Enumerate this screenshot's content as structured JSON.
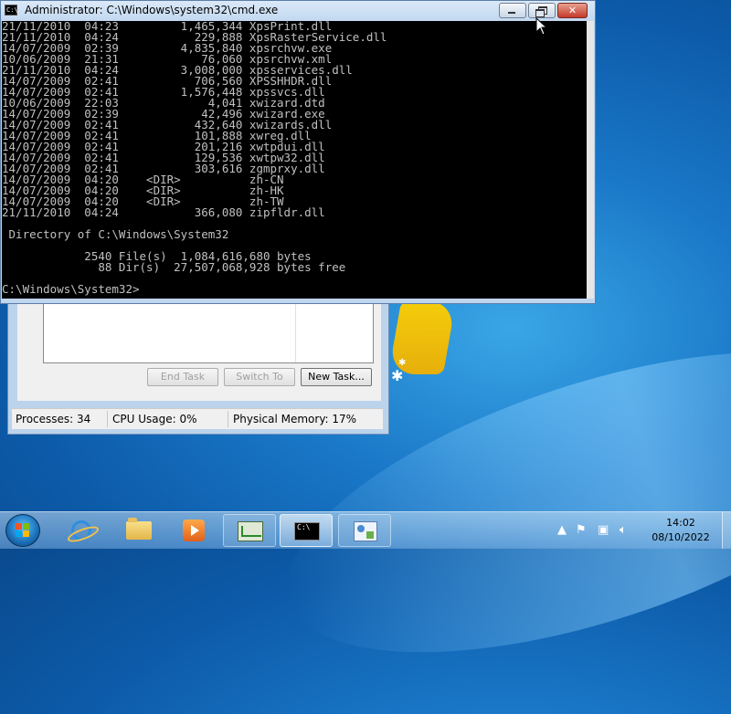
{
  "cmd": {
    "title": "Administrator: C:\\Windows\\system32\\cmd.exe",
    "icon_label": "C:\\",
    "lines": [
      "21/11/2010  04:23         1,465,344 XpsPrint.dll",
      "21/11/2010  04:24           229,888 XpsRasterService.dll",
      "14/07/2009  02:39         4,835,840 xpsrchvw.exe",
      "10/06/2009  21:31            76,060 xpsrchvw.xml",
      "21/11/2010  04:24         3,008,000 xpsservices.dll",
      "14/07/2009  02:41           706,560 XPSSHHDR.dll",
      "14/07/2009  02:41         1,576,448 xpssvcs.dll",
      "10/06/2009  22:03             4,041 xwizard.dtd",
      "14/07/2009  02:39            42,496 xwizard.exe",
      "14/07/2009  02:41           432,640 xwizards.dll",
      "14/07/2009  02:41           101,888 xwreg.dll",
      "14/07/2009  02:41           201,216 xwtpdui.dll",
      "14/07/2009  02:41           129,536 xwtpw32.dll",
      "14/07/2009  02:41           303,616 zgmprxy.dll",
      "14/07/2009  04:20    <DIR>          zh-CN",
      "14/07/2009  04:20    <DIR>          zh-HK",
      "14/07/2009  04:20    <DIR>          zh-TW",
      "21/11/2010  04:24           366,080 zipfldr.dll",
      "",
      " Directory of C:\\Windows\\System32",
      "",
      "            2540 File(s)  1,084,616,680 bytes",
      "              88 Dir(s)  27,507,068,928 bytes free",
      "",
      "C:\\Windows\\System32>"
    ]
  },
  "taskmanager": {
    "buttons": {
      "end_task": "End Task",
      "switch_to": "Switch To",
      "new_task": "New Task..."
    },
    "status": {
      "processes": "Processes: 34",
      "cpu": "CPU Usage: 0%",
      "memory": "Physical Memory: 17%"
    }
  },
  "taskbar": {
    "cmd_icon_label": "C:\\",
    "clock_time": "14:02",
    "clock_date": "08/10/2022"
  },
  "colors": {
    "console_bg": "#000000",
    "console_text": "#c0c0c0",
    "close_button": "#c4392a"
  }
}
